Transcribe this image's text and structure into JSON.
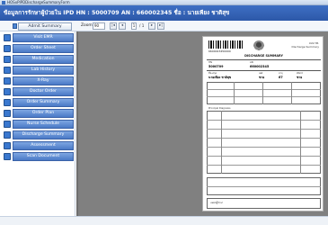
{
  "window": {
    "title": "HOSxPIPDDischargeSummaryForm"
  },
  "header": {
    "text": "ข้อมูลการรักษาผู้ป่วยใน IPD  HN : 5000709 AN : 660002345 ชื่อ : นายเพียง ชาติสุข"
  },
  "toolbar": {
    "admit_summary_label": "Admit Summary",
    "zoom_label": "Zoom",
    "zoom_value": "90",
    "nav_first": "|◂",
    "nav_prev": "◂",
    "page_value": "1",
    "page_total": "/ 1",
    "nav_next": "▸",
    "nav_last": "▸|"
  },
  "sidebar": {
    "items": [
      {
        "label": "Visit EMR",
        "icon": "emr-icon"
      },
      {
        "label": "Order Sheet",
        "icon": "order-sheet-icon"
      },
      {
        "label": "Medication",
        "icon": "medication-icon"
      },
      {
        "label": "Lab History",
        "icon": "lab-icon"
      },
      {
        "label": "X-Ray",
        "icon": "xray-icon"
      },
      {
        "label": "Doctor Order",
        "icon": "doctor-icon"
      },
      {
        "label": "Order Summary",
        "icon": "summary-icon"
      },
      {
        "label": "Order Plan",
        "icon": "plan-icon"
      },
      {
        "label": "Nurse Schedule",
        "icon": "nurse-icon"
      },
      {
        "label": "Discharge Summary",
        "icon": "discharge-icon"
      },
      {
        "label": "Assessment",
        "icon": "assessment-icon"
      },
      {
        "label": "Scan Document",
        "icon": "scan-icon"
      }
    ]
  },
  "document": {
    "barcode_number": "6600023450000",
    "top_right_line1": "แบบ รพ.",
    "top_right_line2": "Discharge Summary",
    "title": "DISCHARGE SUMMARY",
    "hn_label": "HN",
    "hn_value": "5000709",
    "an_label": "AN",
    "an_value": "660002345",
    "name_label": "ชื่อ-สกุล",
    "name_value": "นายเพียง ชาติสุข",
    "sex_label": "เพศ",
    "sex_value": "ชาย",
    "age_label": "อายุ",
    "age_value": "67",
    "ward_label": "Ward",
    "ward_value": "ชาย",
    "dx_label": "Principal Diagnosis",
    "sig_label": "แพทย์ผู้รักษา"
  }
}
